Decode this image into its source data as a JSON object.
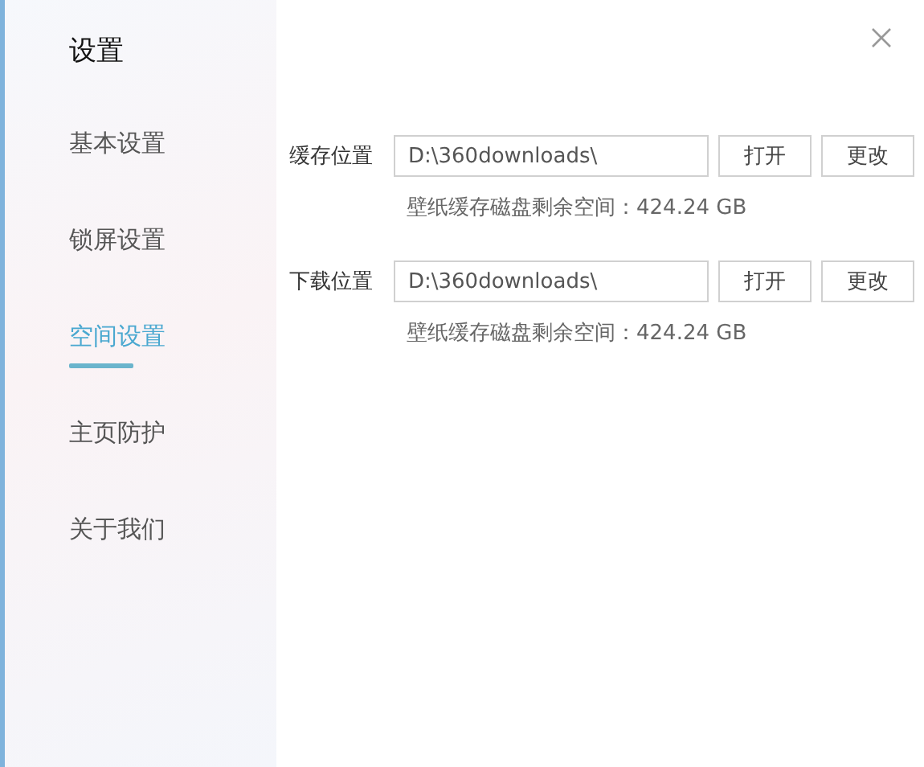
{
  "sidebar": {
    "title": "设置",
    "items": [
      {
        "label": "基本设置",
        "selected": false
      },
      {
        "label": "锁屏设置",
        "selected": false
      },
      {
        "label": "空间设置",
        "selected": true
      },
      {
        "label": "主页防护",
        "selected": false
      },
      {
        "label": "关于我们",
        "selected": false
      }
    ]
  },
  "locations": [
    {
      "label": "缓存位置",
      "value": "D:\\360downloads\\",
      "open_button": "打开",
      "change_button": "更改",
      "hint": "壁纸缓存磁盘剩余空间：424.24 GB"
    },
    {
      "label": "下载位置",
      "value": "D:\\360downloads\\",
      "open_button": "打开",
      "change_button": "更改",
      "hint": "壁纸缓存磁盘剩余空间：424.24 GB"
    }
  ]
}
